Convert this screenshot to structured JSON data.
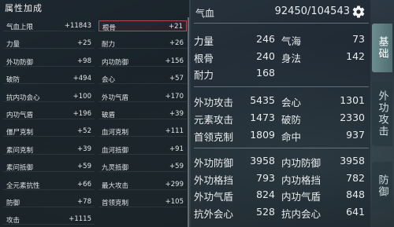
{
  "left": {
    "title": "属性加成",
    "items": [
      {
        "n": "气血上限",
        "v": "+11843"
      },
      {
        "n": "根骨",
        "v": "+21"
      },
      {
        "n": "力量",
        "v": "+25"
      },
      {
        "n": "耐力",
        "v": "+26"
      },
      {
        "n": "外功防御",
        "v": "+98"
      },
      {
        "n": "内功防御",
        "v": "+156"
      },
      {
        "n": "破防",
        "v": "+494"
      },
      {
        "n": "会心",
        "v": "+57"
      },
      {
        "n": "抗内功会心",
        "v": "+100"
      },
      {
        "n": "外功气盾",
        "v": "+170"
      },
      {
        "n": "内功气盾",
        "v": "+196"
      },
      {
        "n": "破盾",
        "v": "+39"
      },
      {
        "n": "僵尸克制",
        "v": "+52"
      },
      {
        "n": "血河克制",
        "v": "+111"
      },
      {
        "n": "素问克制",
        "v": "+39"
      },
      {
        "n": "血河抵御",
        "v": "+91"
      },
      {
        "n": "素问抵御",
        "v": "+59"
      },
      {
        "n": "九灵抵御",
        "v": "+59"
      },
      {
        "n": "全元素抗性",
        "v": "+66"
      },
      {
        "n": "最大攻击",
        "v": "+299"
      },
      {
        "n": "防御",
        "v": "+78"
      },
      {
        "n": "首领克制",
        "v": "+105"
      },
      {
        "n": "攻击",
        "v": "+1115"
      }
    ]
  },
  "right": {
    "hp_label": "气血",
    "hp_value": "92450/104543",
    "s1": [
      {
        "n": "力量",
        "v": "246"
      },
      {
        "n": "气海",
        "v": "73"
      },
      {
        "n": "根骨",
        "v": "240"
      },
      {
        "n": "身法",
        "v": "142"
      },
      {
        "n": "耐力",
        "v": "168"
      }
    ],
    "s2": [
      {
        "n": "外功攻击",
        "v": "5435"
      },
      {
        "n": "会心",
        "v": "1301"
      },
      {
        "n": "元素攻击",
        "v": "1473"
      },
      {
        "n": "破防",
        "v": "2330"
      },
      {
        "n": "首领克制",
        "v": "1809"
      },
      {
        "n": "命中",
        "v": "937"
      }
    ],
    "s3": [
      {
        "n": "外功防御",
        "v": "3958"
      },
      {
        "n": "内功防御",
        "v": "3958"
      },
      {
        "n": "外功格挡",
        "v": "793"
      },
      {
        "n": "内功格挡",
        "v": "782"
      },
      {
        "n": "外功气盾",
        "v": "824"
      },
      {
        "n": "内功气盾",
        "v": "848"
      },
      {
        "n": "抗外会心",
        "v": "528"
      },
      {
        "n": "抗内会心",
        "v": "641"
      }
    ]
  },
  "tabs": [
    "基础",
    "外功攻击",
    "防御"
  ],
  "icons": {
    "settings": "gear-icon"
  }
}
